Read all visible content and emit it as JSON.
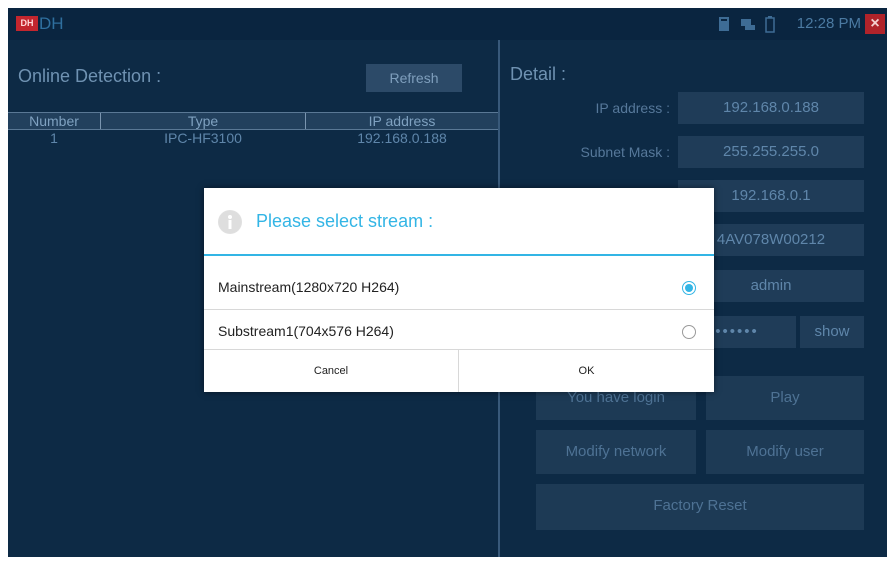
{
  "statusbar": {
    "logo_text": "DH",
    "app_title": "DH",
    "clock": "12:28 PM",
    "icons": [
      "sd-card-icon",
      "ethernet-icon",
      "battery-icon"
    ],
    "close_icon": "close-icon"
  },
  "online_detection": {
    "title": "Online Detection :",
    "refresh_label": "Refresh",
    "columns": [
      "Number",
      "Type",
      "IP address"
    ],
    "rows": [
      {
        "number": "1",
        "type": "IPC-HF3100",
        "ip": "192.168.0.188"
      }
    ]
  },
  "detail": {
    "title": "Detail :",
    "ip_label": "IP address :",
    "ip_value": "192.168.0.188",
    "subnet_label": "Subnet Mask :",
    "subnet_value": "255.255.255.0",
    "gateway_value": "192.168.0.1",
    "serial_value": "4AV078W00212",
    "username_value": "admin",
    "password_value": "••••••",
    "show_label": "show",
    "login_status": "You have login",
    "play_label": "Play",
    "modify_network_label": "Modify network",
    "modify_user_label": "Modify user",
    "factory_reset_label": "Factory Reset"
  },
  "dialog": {
    "title": "Please select stream :",
    "options": [
      {
        "label": "Mainstream(1280x720 H264)",
        "checked": true
      },
      {
        "label": "Substream1(704x576 H264)",
        "checked": false
      }
    ],
    "cancel_label": "Cancel",
    "ok_label": "OK"
  },
  "colors": {
    "background": "#0d2a45",
    "accent": "#33b5e5",
    "close_red": "#b0232a"
  }
}
